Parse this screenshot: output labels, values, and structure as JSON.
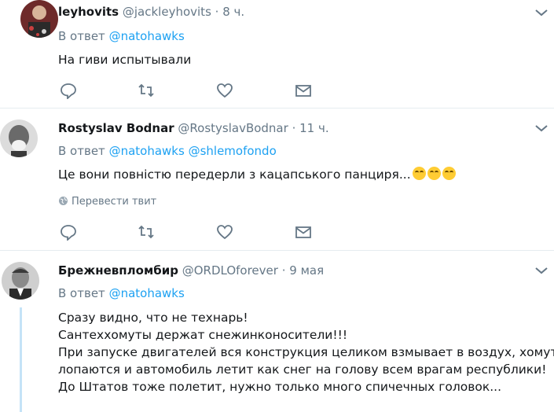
{
  "reply_prefix": "В ответ",
  "tweets": [
    {
      "name": "leyhovits",
      "handle": "@jackleyhovits",
      "time": "8 ч.",
      "mentions": [
        "@natohawks"
      ],
      "lines": [
        "На гиви испытывали"
      ],
      "translate": ""
    },
    {
      "name": "Rostyslav Bodnar",
      "handle": "@RostyslavBodnar",
      "time": "11 ч.",
      "mentions": [
        "@natohawks",
        "@shlemofondo"
      ],
      "lines": [
        "Це вони повністю передерли з кацапського панциря..."
      ],
      "emoji_count": 3,
      "translate": "Перевести твит"
    },
    {
      "name": "Брежневпломбир",
      "handle": "@ORDLOforever",
      "time": "9 мая",
      "mentions": [
        "@natohawks"
      ],
      "lines": [
        "Сразу видно, что не технарь!",
        "Сантеххомуты держат снежинконосители!!!",
        "При запуске двигателей вся конструкция целиком взмывает в воздух, хомуты",
        "лопаются и автомобиль летит как снег на голову всем врагам республики!",
        "До Штатов тоже полетит, нужно только много спичечных головок..."
      ],
      "translate": ""
    }
  ],
  "colors": {
    "link": "#1da1f2",
    "muted": "#657786",
    "text": "#14171a",
    "separator": "#e6ecf0",
    "thread": "#c4e3f7"
  },
  "icons": [
    "reply-icon",
    "retweet-icon",
    "like-icon",
    "dm-icon",
    "chevron-down-icon",
    "globe-icon"
  ]
}
